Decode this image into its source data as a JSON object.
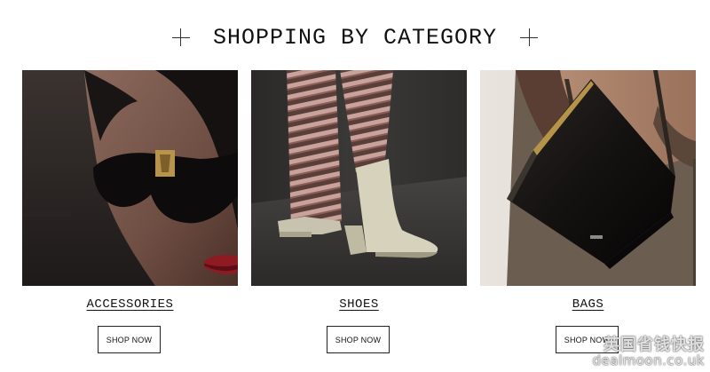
{
  "section": {
    "title": "SHOPPING BY CATEGORY"
  },
  "categories": [
    {
      "label": "ACCESSORIES",
      "button": "SHOP NOW"
    },
    {
      "label": "SHOES",
      "button": "SHOP NOW"
    },
    {
      "label": "BAGS",
      "button": "SHOP NOW"
    }
  ],
  "watermark": {
    "line1": "英国省钱快报",
    "line2": "dealmoon.co.uk"
  },
  "colors": {
    "text": "#111111",
    "button_border": "#222222",
    "background": "#ffffff"
  }
}
